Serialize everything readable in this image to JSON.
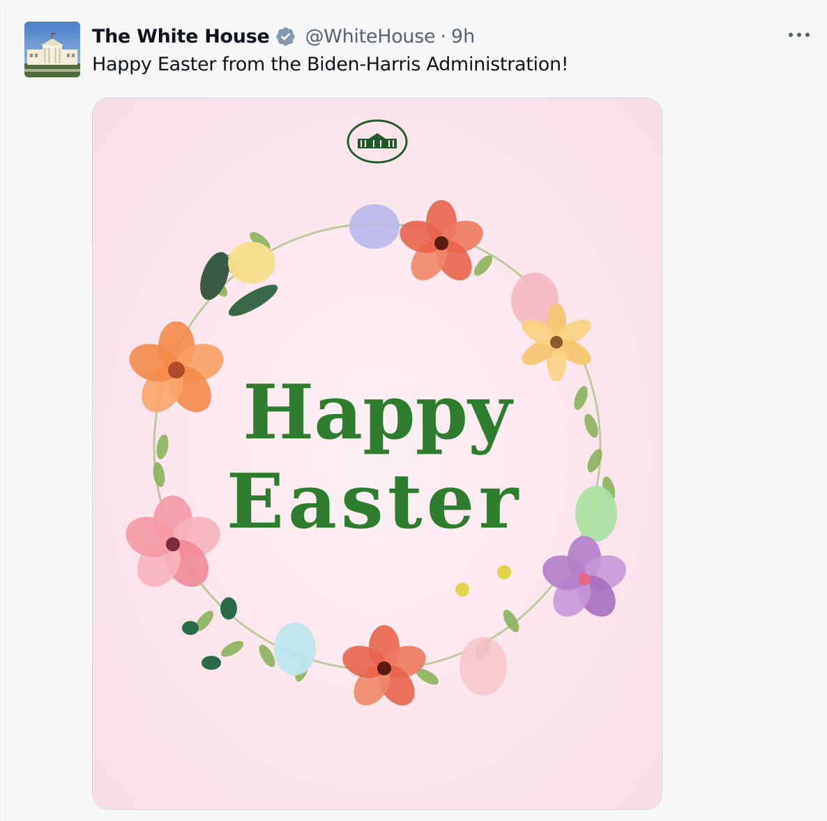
{
  "tweet": {
    "author": {
      "display_name": "The White House",
      "handle": "@WhiteHouse",
      "verified": true,
      "avatar_icon": "white-house-avatar-icon"
    },
    "separator": "·",
    "time": "9h",
    "text": "Happy Easter from the Biden-Harris Administration!",
    "more_icon": "more-options-icon",
    "media": {
      "card_text_line1": "Happy",
      "card_text_line2": "Easter",
      "seal_icon": "white-house-seal-icon",
      "background_color": "#fbe3ec",
      "text_color": "#2e7d2e"
    }
  },
  "colors": {
    "verified_badge": "#829aab",
    "secondary_text": "#536471",
    "primary_text": "#0f1419"
  }
}
